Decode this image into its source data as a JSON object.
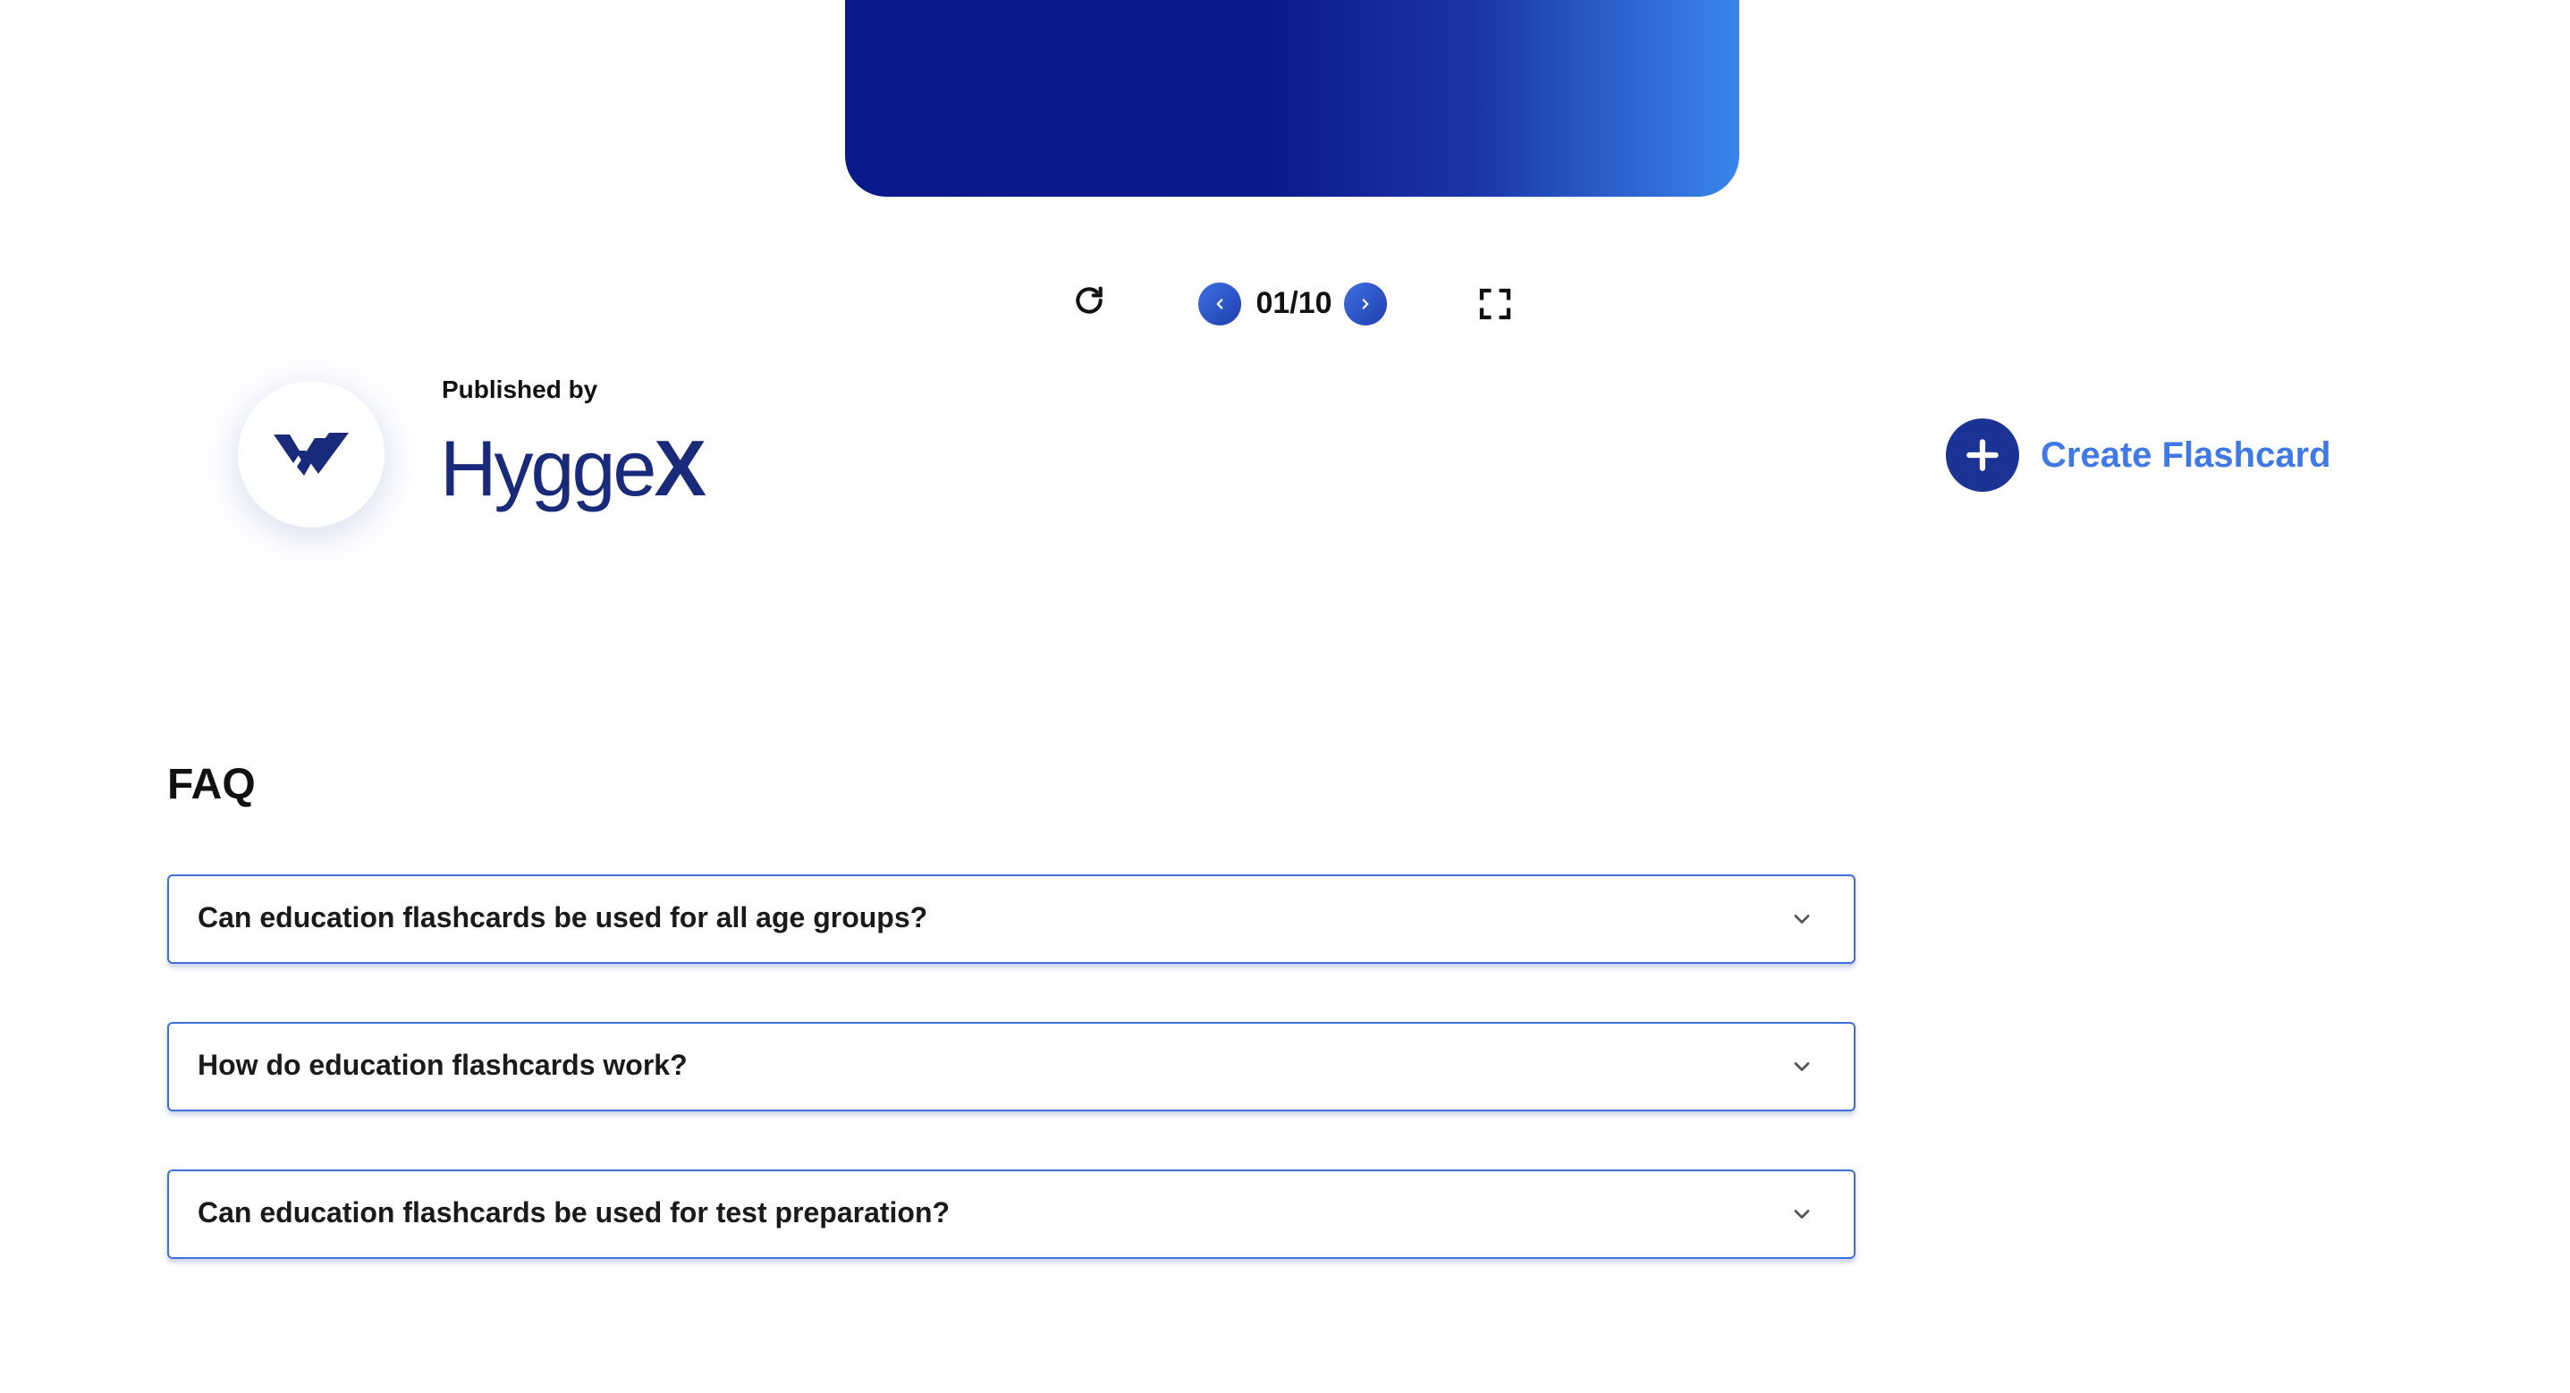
{
  "flashcard": {
    "counter": "01/10",
    "gradient_colors": [
      "#0b1a8a",
      "#3a86ea"
    ]
  },
  "controls": {
    "refresh_icon": "refresh-icon",
    "prev_icon": "chevron-left-icon",
    "next_icon": "chevron-right-icon",
    "fullscreen_icon": "fullscreen-icon"
  },
  "publisher": {
    "label": "Published by",
    "brand_name_main": "Hygge",
    "brand_name_x": "X"
  },
  "create": {
    "label": "Create Flashcard",
    "icon": "plus-icon"
  },
  "faq": {
    "title": "FAQ",
    "items": [
      {
        "question": "Can education flashcards be used for all age groups?"
      },
      {
        "question": "How do education flashcards work?"
      },
      {
        "question": "Can education flashcards be used for test preparation?"
      }
    ]
  },
  "colors": {
    "accent": "#4079e6",
    "brand_dark": "#1a3394",
    "border": "#3f6fd9"
  }
}
